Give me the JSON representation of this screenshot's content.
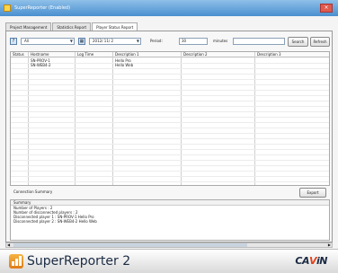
{
  "window": {
    "title": "SuperReporter (Enabled)"
  },
  "tabs": [
    {
      "label": "Project Management",
      "active": false
    },
    {
      "label": "Statistics Report",
      "active": false
    },
    {
      "label": "Player Status Report",
      "active": true
    }
  ],
  "toolbar": {
    "player_select": "All",
    "date_value": "2012/ 11/ 2",
    "period_label": "Period:",
    "period_value": "30",
    "minutes_label": "minutes",
    "filter_value": "",
    "search_label": "Search",
    "refresh_label": "Refresh"
  },
  "grid": {
    "columns": [
      "Status",
      "Hostname",
      "Log Time",
      "Description 1",
      "Description 2",
      "Description 3"
    ],
    "rows": [
      {
        "status": "",
        "hostname": "SN-PROV-1",
        "log_time": "",
        "desc1": "Hello Pro",
        "desc2": "",
        "desc3": ""
      },
      {
        "status": "",
        "hostname": "SN-WEB4-2",
        "log_time": "",
        "desc1": "Hello Web",
        "desc2": "",
        "desc3": ""
      }
    ]
  },
  "connection_summary": {
    "title": "Connection Summary",
    "export_label": "Export",
    "header": "Summary",
    "lines": [
      "Number of Players : 2",
      "Number of disconnected players : 2",
      "Disconnected player 1 : SN-PROV-1 Hello Pro",
      "Disconnected player 2 : SN-WEB4-2 Hello Web"
    ]
  },
  "footer": {
    "brand": "SuperReporter 2",
    "vendor_prefix": "CA",
    "vendor_accent": "V",
    "vendor_suffix": "iN"
  },
  "colors": {
    "accent": "#4a8fd0",
    "brand_orange": "#e07b18",
    "vendor_red": "#e3431c"
  }
}
